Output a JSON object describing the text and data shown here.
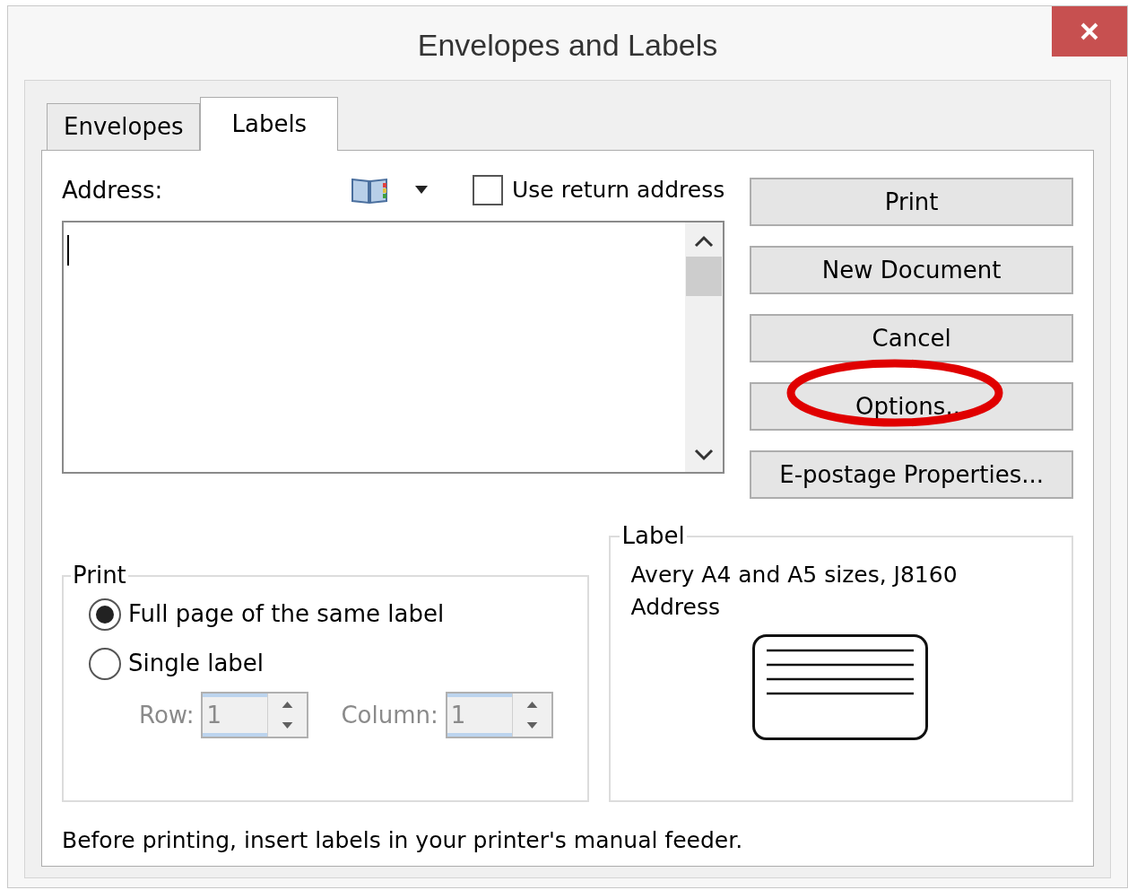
{
  "window": {
    "title": "Envelopes and Labels"
  },
  "tabs": [
    {
      "label": "Envelopes",
      "selected": false
    },
    {
      "label": "Labels",
      "selected": true
    }
  ],
  "address": {
    "label": "Address:",
    "use_return_address": {
      "label": "Use return address",
      "checked": false
    }
  },
  "buttons": [
    {
      "label": "Print",
      "highlighted": false
    },
    {
      "label": "New Document",
      "highlighted": false
    },
    {
      "label": "Cancel",
      "highlighted": false
    },
    {
      "label": "Options...",
      "highlighted": true
    },
    {
      "label": "E-postage Properties...",
      "highlighted": false
    }
  ],
  "print_group": {
    "title": "Print",
    "options": [
      {
        "label": "Full page of the same label",
        "selected": true
      },
      {
        "label": "Single label",
        "selected": false
      }
    ],
    "row": {
      "label": "Row:",
      "value": "1",
      "disabled": true
    },
    "column": {
      "label": "Column:",
      "value": "1",
      "disabled": true
    }
  },
  "label_group": {
    "title": "Label",
    "lines": [
      "Avery A4 and A5 sizes, J8160",
      "Address"
    ]
  },
  "footer": "Before printing, insert labels in your printer's manual feeder."
}
